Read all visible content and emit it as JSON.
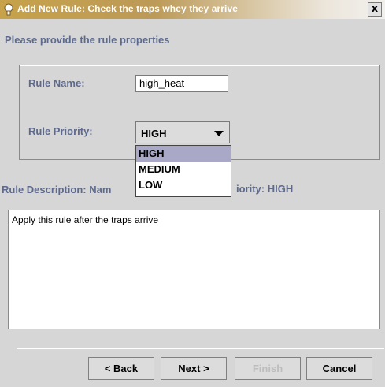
{
  "window": {
    "title": "Add New Rule: Check the traps whey they arrive",
    "close_label": "x"
  },
  "instructions": "Please provide the rule properties",
  "form": {
    "rule_name_label": "Rule Name:",
    "rule_name_value": "high_heat",
    "rule_priority_label": "Rule Priority:",
    "rule_priority_value": "HIGH",
    "priority_options": [
      "HIGH",
      "MEDIUM",
      "LOW"
    ],
    "priority_selected_index": 0
  },
  "description": {
    "label_left": "Rule Description: Nam",
    "label_right": "iority: HIGH",
    "text": "Apply this rule after the traps arrive"
  },
  "buttons": {
    "back": "< Back",
    "next": "Next >",
    "finish": "Finish",
    "cancel": "Cancel"
  },
  "colors": {
    "label_blue": "#5d6a8e",
    "selected_option": "#a9a9c7"
  }
}
